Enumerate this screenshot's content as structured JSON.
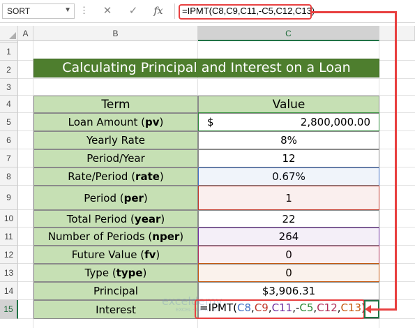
{
  "formula_bar": {
    "name_box": "SORT",
    "cancel_glyph": "✕",
    "enter_glyph": "✓",
    "fx_label": "fx",
    "formula": "=IPMT(C8,C9,C11,-C5,C12,C13)"
  },
  "columns": [
    "A",
    "B",
    "C"
  ],
  "rows": [
    "1",
    "2",
    "3",
    "4",
    "5",
    "6",
    "7",
    "8",
    "9",
    "10",
    "11",
    "12",
    "13",
    "14",
    "15"
  ],
  "active_row": "15",
  "active_column": "C",
  "title": "Calculating Principal and Interest on a Loan",
  "table": {
    "header_term": "Term",
    "header_value": "Value",
    "rows": [
      {
        "term": "Loan Amount (",
        "arg": "pv",
        "close": ")",
        "value_symbol": "$",
        "value": "2,800,000.00"
      },
      {
        "term": "Yearly Rate",
        "arg": "",
        "close": "",
        "value": "8%"
      },
      {
        "term": "Period/Year",
        "arg": "",
        "close": "",
        "value": "12"
      },
      {
        "term": "Rate/Period (",
        "arg": "rate",
        "close": ")",
        "value": "0.67%"
      },
      {
        "term": "Period (",
        "arg": "per",
        "close": ")",
        "value": "1"
      },
      {
        "term": "Total Period (",
        "arg": "year",
        "close": ")",
        "value": "22"
      },
      {
        "term": "Number of Periods (",
        "arg": "nper",
        "close": ")",
        "value": "264"
      },
      {
        "term": "Future Value (",
        "arg": "fv",
        "close": ")",
        "value": "0"
      },
      {
        "term": "Type (",
        "arg": "type",
        "close": ")",
        "value": "0"
      },
      {
        "term": "Principal",
        "arg": "",
        "close": "",
        "value": "$3,906.31"
      },
      {
        "term": "Interest",
        "arg": "",
        "close": "",
        "value": ""
      }
    ]
  },
  "cell_formula": {
    "prefix": "=IPMT(",
    "parts": [
      {
        "text": "C8",
        "color": "#4472c4"
      },
      {
        "text": ",",
        "color": "#000000"
      },
      {
        "text": "C9",
        "color": "#c0392b"
      },
      {
        "text": ",",
        "color": "#000000"
      },
      {
        "text": "C11",
        "color": "#7030a0"
      },
      {
        "text": ",-",
        "color": "#000000"
      },
      {
        "text": "C5",
        "color": "#2e8b3a"
      },
      {
        "text": ",",
        "color": "#000000"
      },
      {
        "text": "C12",
        "color": "#b0305a"
      },
      {
        "text": ",",
        "color": "#000000"
      },
      {
        "text": "C13",
        "color": "#c55a11"
      },
      {
        "text": ")",
        "color": "#000000"
      }
    ]
  },
  "watermark": {
    "main": "exceldemy",
    "sub": "EXCEL · DATA · BI"
  },
  "colors": {
    "title_bg": "#4e7e2e",
    "term_bg": "#c6e0b4",
    "highlight_red": "#e84040",
    "excel_green": "#217346"
  }
}
